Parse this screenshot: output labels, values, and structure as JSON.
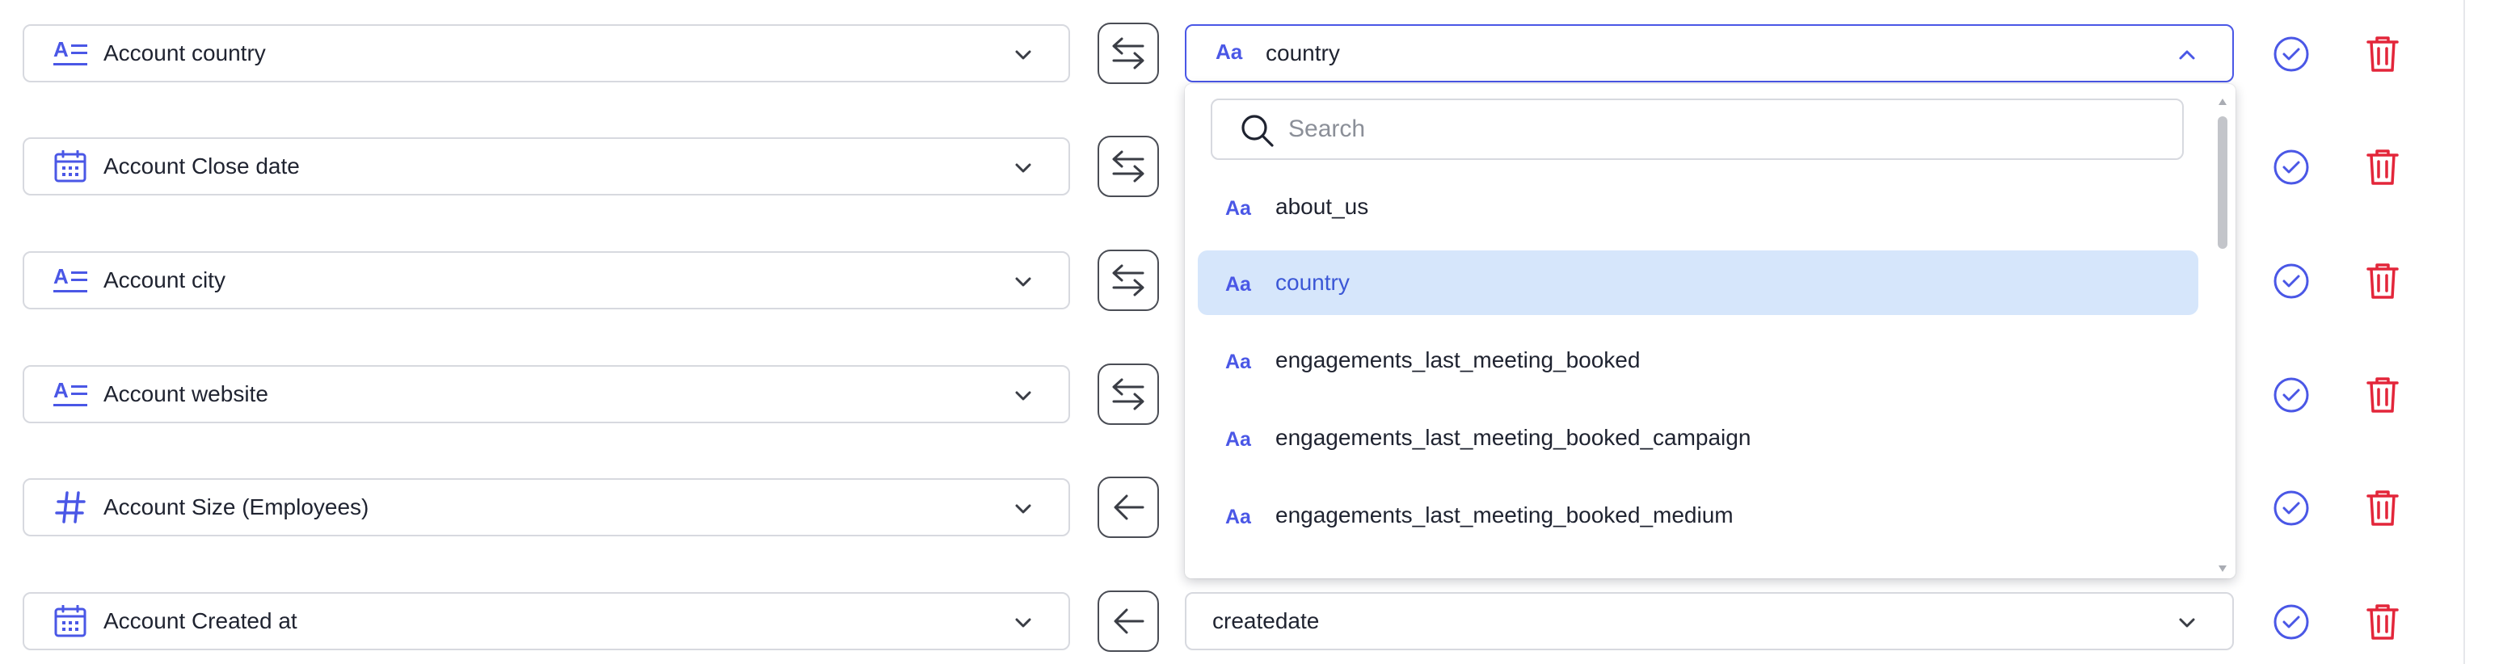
{
  "colors": {
    "accent": "#4a57e6",
    "danger": "#e3263a",
    "selected_bg": "#d6e6fb",
    "selected_text": "#3b57d6",
    "border": "#d7d9df"
  },
  "rows": [
    {
      "source": "Account country",
      "source_icon": "text-field-icon",
      "direction": "bidirectional-arrows-icon",
      "destination": "country",
      "dest_icon": "text-type-icon"
    },
    {
      "source": "Account Close date",
      "source_icon": "calendar-icon",
      "direction": "bidirectional-arrows-icon",
      "destination": "",
      "dest_icon": ""
    },
    {
      "source": "Account city",
      "source_icon": "text-field-icon",
      "direction": "bidirectional-arrows-icon",
      "destination": "",
      "dest_icon": ""
    },
    {
      "source": "Account website",
      "source_icon": "text-field-icon",
      "direction": "bidirectional-arrows-icon",
      "destination": "",
      "dest_icon": ""
    },
    {
      "source": "Account Size (Employees)",
      "source_icon": "hash-icon",
      "direction": "arrow-left-icon",
      "destination": "",
      "dest_icon": ""
    },
    {
      "source": "Account Created at",
      "source_icon": "calendar-icon",
      "direction": "arrow-left-icon",
      "destination": "createdate",
      "dest_icon": ""
    }
  ],
  "dropdown": {
    "search_placeholder": "Search",
    "search_value": "",
    "options": [
      {
        "label": "about_us",
        "selected": false
      },
      {
        "label": "country",
        "selected": true
      },
      {
        "label": "engagements_last_meeting_booked",
        "selected": false
      },
      {
        "label": "engagements_last_meeting_booked_campaign",
        "selected": false
      },
      {
        "label": "engagements_last_meeting_booked_medium",
        "selected": false
      }
    ]
  }
}
